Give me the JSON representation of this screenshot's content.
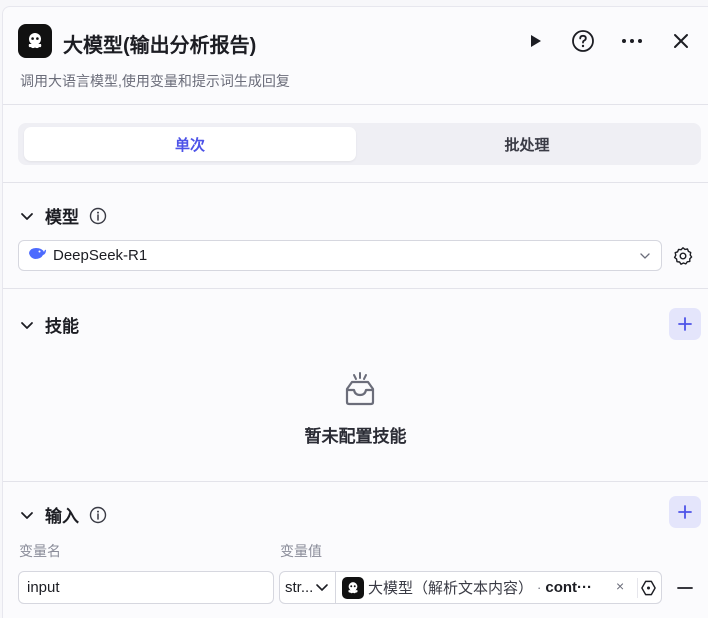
{
  "header": {
    "title": "大模型(输出分析报告)",
    "description": "调用大语言模型,使用变量和提示词生成回复",
    "icons": [
      "node-logo-icon",
      "play-icon",
      "help-icon",
      "more-icon",
      "close-icon"
    ]
  },
  "tabs": {
    "single": "单次",
    "batch": "批处理",
    "active": "单次"
  },
  "model_section": {
    "title": "模型",
    "selected_model": "DeepSeek-R1"
  },
  "skills_section": {
    "title": "技能",
    "empty_text": "暂未配置技能"
  },
  "input_section": {
    "title": "输入",
    "col_name": "变量名",
    "col_value": "变量值",
    "rows": [
      {
        "name": "input",
        "type": "str...",
        "ref_node": "大模型（解析文本内容）",
        "ref_sep": "·",
        "ref_field": "cont···",
        "clear": "×"
      }
    ]
  },
  "colors": {
    "accent": "#4d53e8",
    "accent_bg": "#e4e5fb",
    "node_icon_bg": "#111111"
  }
}
